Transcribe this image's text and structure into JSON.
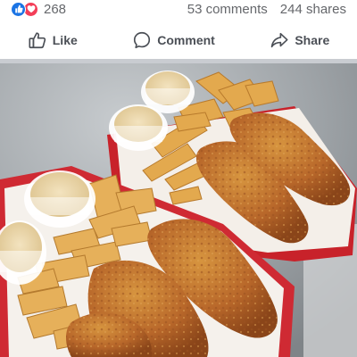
{
  "post": {
    "reaction_count": "268",
    "comments": "53 comments",
    "shares": "244 shares",
    "reactions": [
      {
        "icon": "like-reaction-icon",
        "color": "#1b74e4"
      },
      {
        "icon": "love-reaction-icon",
        "color": "#f33e58"
      }
    ]
  },
  "actions": {
    "like_label": "Like",
    "comment_label": "Comment",
    "share_label": "Share"
  },
  "photo": {
    "icon": "food-photo"
  }
}
